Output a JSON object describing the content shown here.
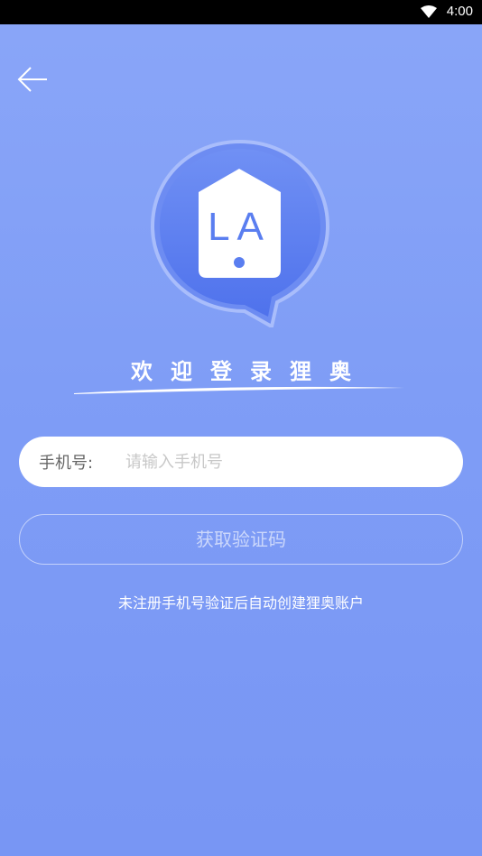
{
  "status_bar": {
    "time": "4:00",
    "wifi_icon": "wifi-icon"
  },
  "nav": {
    "back_icon": "arrow-left-icon"
  },
  "logo": {
    "text": "LA",
    "icon": "location-pin-tag-icon"
  },
  "welcome_text": "欢迎登录狸奥",
  "phone": {
    "label": "手机号:",
    "placeholder": "请输入手机号",
    "value": ""
  },
  "get_code_label": "获取验证码",
  "hint_text": "未注册手机号验证后自动创建狸奥账户",
  "colors": {
    "background": "#8aa6f8",
    "logo_blue": "#5a7ef0",
    "white": "#ffffff"
  }
}
